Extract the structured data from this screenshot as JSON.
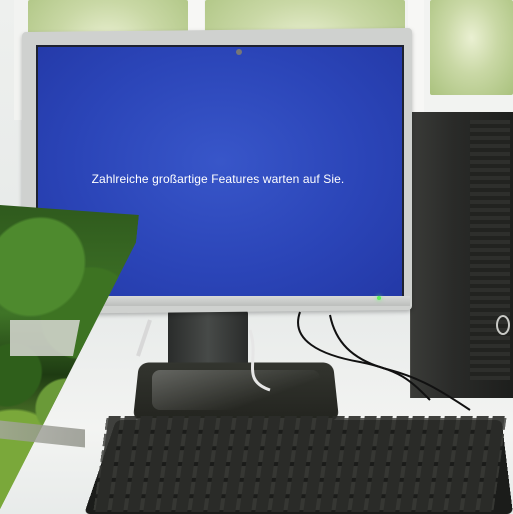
{
  "photo": {
    "screen_message": "Zahlreiche großartige Features warten auf Sie.",
    "colors": {
      "screen_blue": "#2b45b8",
      "power_led": "#5ff05a",
      "foliage": "#3f7427",
      "device_black": "#1d1e1c"
    },
    "icons": [
      "monitor-icon",
      "keyboard-icon",
      "pc-tower-icon"
    ]
  }
}
